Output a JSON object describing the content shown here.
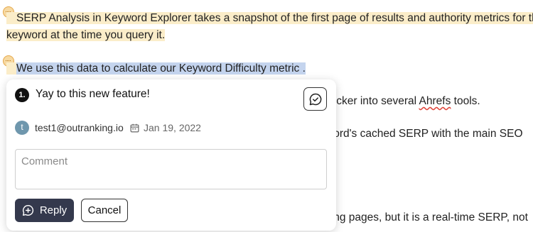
{
  "document": {
    "paragraph1_line1": "SERP Analysis in Keyword Explorer takes a snapshot of the first page of results and authority metrics for that",
    "paragraph1_line2": "keyword at the time you query it.",
    "paragraph2": "We use this data to calculate our Keyword Difficulty metric .",
    "partial_line3_prefix": "hecker into several ",
    "partial_line3_spell": "Ahrefs",
    "partial_line3_suffix": " tools.",
    "partial_line4": "word's cached SERP with the main SEO",
    "partial_line5": "king pages, but it is a real-time SERP, not"
  },
  "comment": {
    "number": "1.",
    "text": "Yay to this new feature!",
    "author_initial": "t",
    "author": "test1@outranking.io",
    "date": "Jan 19, 2022",
    "input_placeholder": "Comment",
    "reply_label": "Reply",
    "cancel_label": "Cancel"
  },
  "colors": {
    "highlight_yellow": "#fbedc9",
    "highlight_blue": "#c4d4ee",
    "reply_button": "#34394d",
    "avatar": "#6f97ad"
  },
  "icons": [
    "comment-marker-icon",
    "resolve-comment-icon",
    "calendar-icon",
    "reply-plus-icon"
  ]
}
